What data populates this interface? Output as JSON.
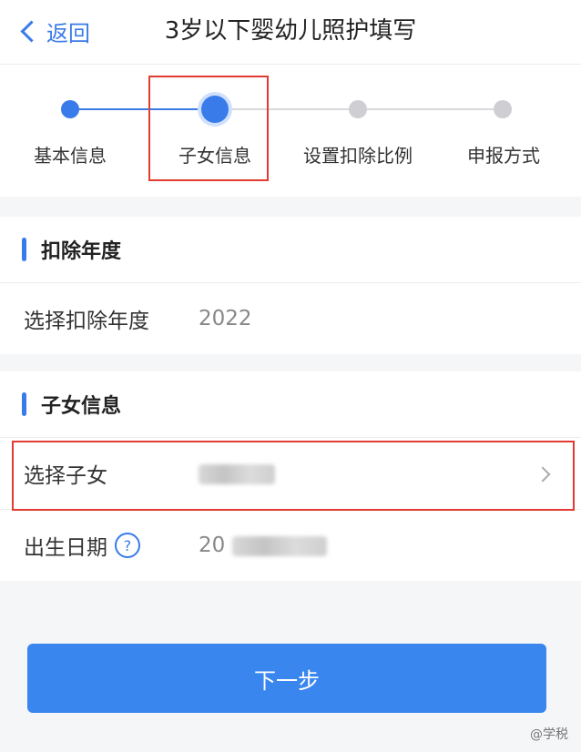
{
  "header": {
    "back_label": "返回",
    "title": "3岁以下婴幼儿照护填写"
  },
  "steps": [
    {
      "label": "基本信息",
      "state": "done"
    },
    {
      "label": "子女信息",
      "state": "active"
    },
    {
      "label": "设置扣除比例",
      "state": "todo"
    },
    {
      "label": "申报方式",
      "state": "todo"
    }
  ],
  "section_year": {
    "title": "扣除年度",
    "row_label": "选择扣除年度",
    "row_value": "2022"
  },
  "section_child": {
    "title": "子女信息",
    "select_label": "选择子女",
    "birth_label": "出生日期",
    "birth_value_prefix": "20",
    "help_icon_text": "?"
  },
  "next_button": "下一步",
  "watermark": "@学税",
  "colors": {
    "accent": "#3a7bea",
    "highlight": "#e23b31",
    "button": "#3a86ef",
    "inactive": "#cfcfd3"
  }
}
